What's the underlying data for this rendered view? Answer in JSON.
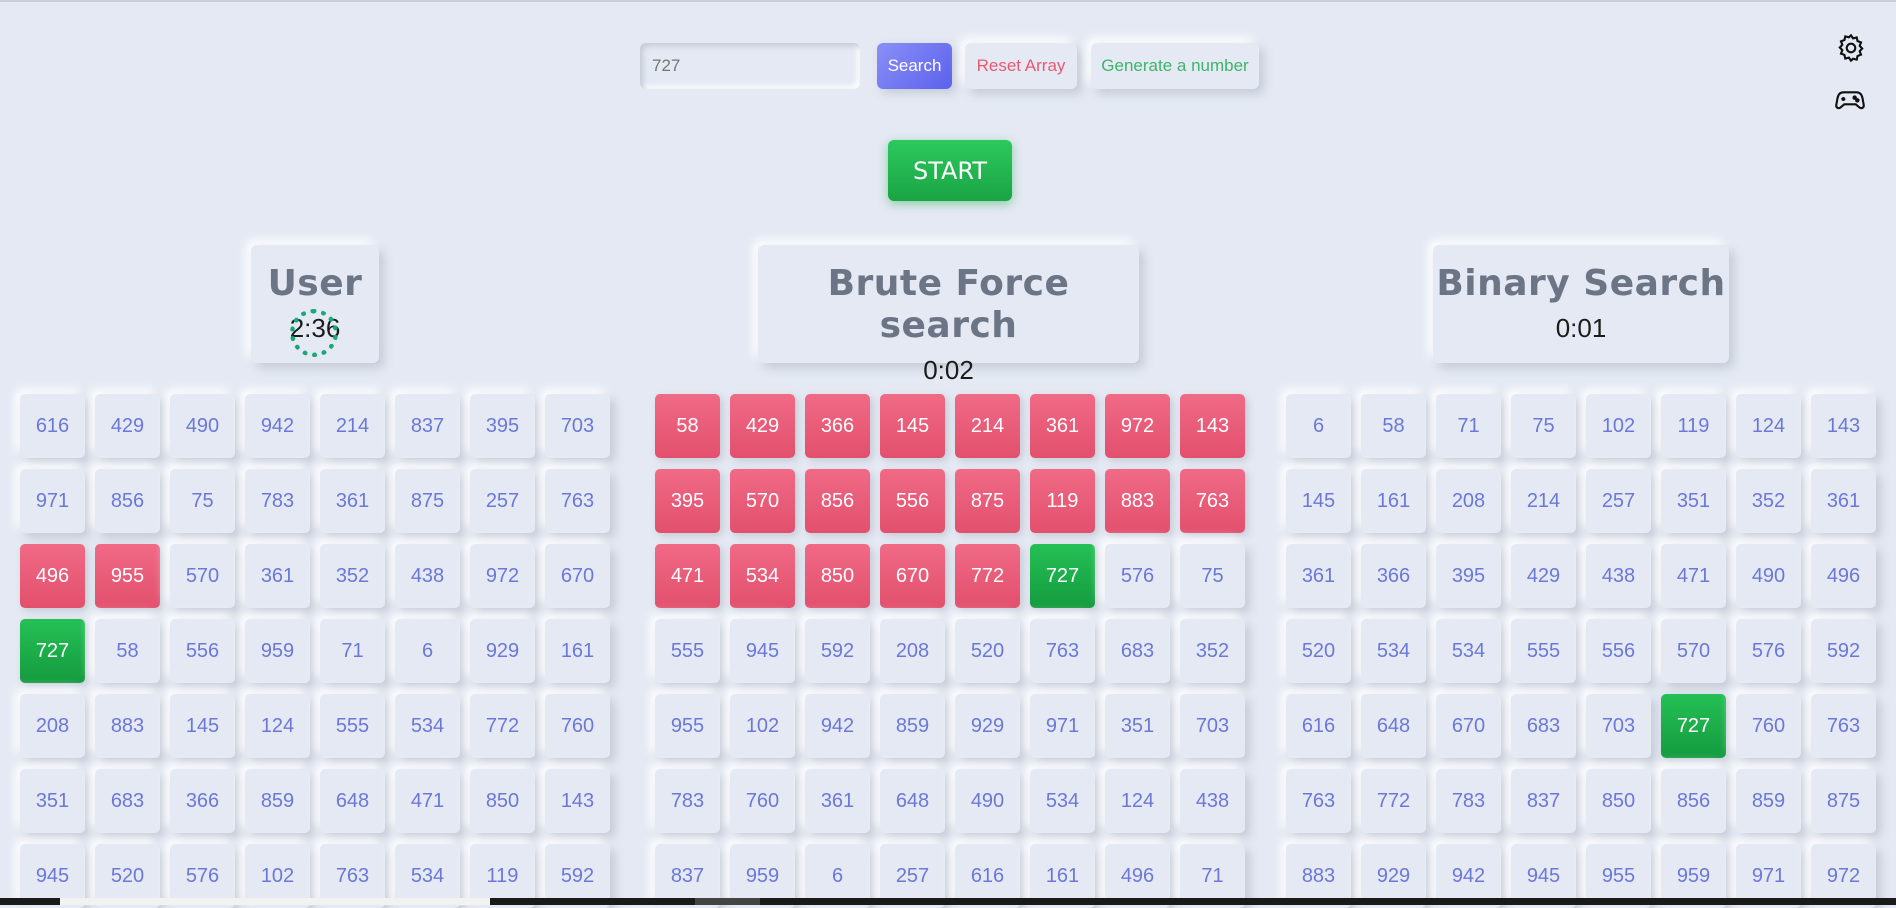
{
  "search": {
    "placeholder": "727"
  },
  "buttons": {
    "search": "Search",
    "reset": "Reset Array",
    "generate": "Generate a number",
    "start": "START"
  },
  "icons": {
    "settings": "gear-icon",
    "game": "gamepad-icon"
  },
  "colors": {
    "miss": "#e95a77",
    "found": "#1fb14c",
    "accent": "#6b6ff2",
    "number_text": "#6b78d8"
  },
  "panels": {
    "user": {
      "title": "User",
      "timer": "2:36",
      "cells": [
        [
          "616",
          "default"
        ],
        [
          "429",
          "default"
        ],
        [
          "490",
          "default"
        ],
        [
          "942",
          "default"
        ],
        [
          "214",
          "default"
        ],
        [
          "837",
          "default"
        ],
        [
          "395",
          "default"
        ],
        [
          "703",
          "default"
        ],
        [
          "971",
          "default"
        ],
        [
          "856",
          "default"
        ],
        [
          "75",
          "default"
        ],
        [
          "783",
          "default"
        ],
        [
          "361",
          "default"
        ],
        [
          "875",
          "default"
        ],
        [
          "257",
          "default"
        ],
        [
          "763",
          "default"
        ],
        [
          "496",
          "miss"
        ],
        [
          "955",
          "miss"
        ],
        [
          "570",
          "default"
        ],
        [
          "361",
          "default"
        ],
        [
          "352",
          "default"
        ],
        [
          "438",
          "default"
        ],
        [
          "972",
          "default"
        ],
        [
          "670",
          "default"
        ],
        [
          "727",
          "found"
        ],
        [
          "58",
          "default"
        ],
        [
          "556",
          "default"
        ],
        [
          "959",
          "default"
        ],
        [
          "71",
          "default"
        ],
        [
          "6",
          "default"
        ],
        [
          "929",
          "default"
        ],
        [
          "161",
          "default"
        ],
        [
          "208",
          "default"
        ],
        [
          "883",
          "default"
        ],
        [
          "145",
          "default"
        ],
        [
          "124",
          "default"
        ],
        [
          "555",
          "default"
        ],
        [
          "534",
          "default"
        ],
        [
          "772",
          "default"
        ],
        [
          "760",
          "default"
        ],
        [
          "351",
          "default"
        ],
        [
          "683",
          "default"
        ],
        [
          "366",
          "default"
        ],
        [
          "859",
          "default"
        ],
        [
          "648",
          "default"
        ],
        [
          "471",
          "default"
        ],
        [
          "850",
          "default"
        ],
        [
          "143",
          "default"
        ],
        [
          "945",
          "default"
        ],
        [
          "520",
          "default"
        ],
        [
          "576",
          "default"
        ],
        [
          "102",
          "default"
        ],
        [
          "763",
          "default"
        ],
        [
          "534",
          "default"
        ],
        [
          "119",
          "default"
        ],
        [
          "592",
          "default"
        ]
      ]
    },
    "brute": {
      "title": "Brute Force search",
      "timer": "0:02",
      "cells": [
        [
          "58",
          "miss"
        ],
        [
          "429",
          "miss"
        ],
        [
          "366",
          "miss"
        ],
        [
          "145",
          "miss"
        ],
        [
          "214",
          "miss"
        ],
        [
          "361",
          "miss"
        ],
        [
          "972",
          "miss"
        ],
        [
          "143",
          "miss"
        ],
        [
          "395",
          "miss"
        ],
        [
          "570",
          "miss"
        ],
        [
          "856",
          "miss"
        ],
        [
          "556",
          "miss"
        ],
        [
          "875",
          "miss"
        ],
        [
          "119",
          "miss"
        ],
        [
          "883",
          "miss"
        ],
        [
          "763",
          "miss"
        ],
        [
          "471",
          "miss"
        ],
        [
          "534",
          "miss"
        ],
        [
          "850",
          "miss"
        ],
        [
          "670",
          "miss"
        ],
        [
          "772",
          "miss"
        ],
        [
          "727",
          "found"
        ],
        [
          "576",
          "default"
        ],
        [
          "75",
          "default"
        ],
        [
          "555",
          "default"
        ],
        [
          "945",
          "default"
        ],
        [
          "592",
          "default"
        ],
        [
          "208",
          "default"
        ],
        [
          "520",
          "default"
        ],
        [
          "763",
          "default"
        ],
        [
          "683",
          "default"
        ],
        [
          "352",
          "default"
        ],
        [
          "955",
          "default"
        ],
        [
          "102",
          "default"
        ],
        [
          "942",
          "default"
        ],
        [
          "859",
          "default"
        ],
        [
          "929",
          "default"
        ],
        [
          "971",
          "default"
        ],
        [
          "351",
          "default"
        ],
        [
          "703",
          "default"
        ],
        [
          "783",
          "default"
        ],
        [
          "760",
          "default"
        ],
        [
          "361",
          "default"
        ],
        [
          "648",
          "default"
        ],
        [
          "490",
          "default"
        ],
        [
          "534",
          "default"
        ],
        [
          "124",
          "default"
        ],
        [
          "438",
          "default"
        ],
        [
          "837",
          "default"
        ],
        [
          "959",
          "default"
        ],
        [
          "6",
          "default"
        ],
        [
          "257",
          "default"
        ],
        [
          "616",
          "default"
        ],
        [
          "161",
          "default"
        ],
        [
          "496",
          "default"
        ],
        [
          "71",
          "default"
        ]
      ]
    },
    "binary": {
      "title": "Binary Search",
      "timer": "0:01",
      "cells": [
        [
          "6",
          "default"
        ],
        [
          "58",
          "default"
        ],
        [
          "71",
          "default"
        ],
        [
          "75",
          "default"
        ],
        [
          "102",
          "default"
        ],
        [
          "119",
          "default"
        ],
        [
          "124",
          "default"
        ],
        [
          "143",
          "default"
        ],
        [
          "145",
          "default"
        ],
        [
          "161",
          "default"
        ],
        [
          "208",
          "default"
        ],
        [
          "214",
          "default"
        ],
        [
          "257",
          "default"
        ],
        [
          "351",
          "default"
        ],
        [
          "352",
          "default"
        ],
        [
          "361",
          "default"
        ],
        [
          "361",
          "default"
        ],
        [
          "366",
          "default"
        ],
        [
          "395",
          "default"
        ],
        [
          "429",
          "default"
        ],
        [
          "438",
          "default"
        ],
        [
          "471",
          "default"
        ],
        [
          "490",
          "default"
        ],
        [
          "496",
          "default"
        ],
        [
          "520",
          "default"
        ],
        [
          "534",
          "default"
        ],
        [
          "534",
          "default"
        ],
        [
          "555",
          "default"
        ],
        [
          "556",
          "default"
        ],
        [
          "570",
          "default"
        ],
        [
          "576",
          "default"
        ],
        [
          "592",
          "default"
        ],
        [
          "616",
          "default"
        ],
        [
          "648",
          "default"
        ],
        [
          "670",
          "default"
        ],
        [
          "683",
          "default"
        ],
        [
          "703",
          "default"
        ],
        [
          "727",
          "found"
        ],
        [
          "760",
          "default"
        ],
        [
          "763",
          "default"
        ],
        [
          "763",
          "default"
        ],
        [
          "772",
          "default"
        ],
        [
          "783",
          "default"
        ],
        [
          "837",
          "default"
        ],
        [
          "850",
          "default"
        ],
        [
          "856",
          "default"
        ],
        [
          "859",
          "default"
        ],
        [
          "875",
          "default"
        ],
        [
          "883",
          "default"
        ],
        [
          "929",
          "default"
        ],
        [
          "942",
          "default"
        ],
        [
          "945",
          "default"
        ],
        [
          "955",
          "default"
        ],
        [
          "959",
          "default"
        ],
        [
          "971",
          "default"
        ],
        [
          "972",
          "default"
        ]
      ]
    }
  }
}
